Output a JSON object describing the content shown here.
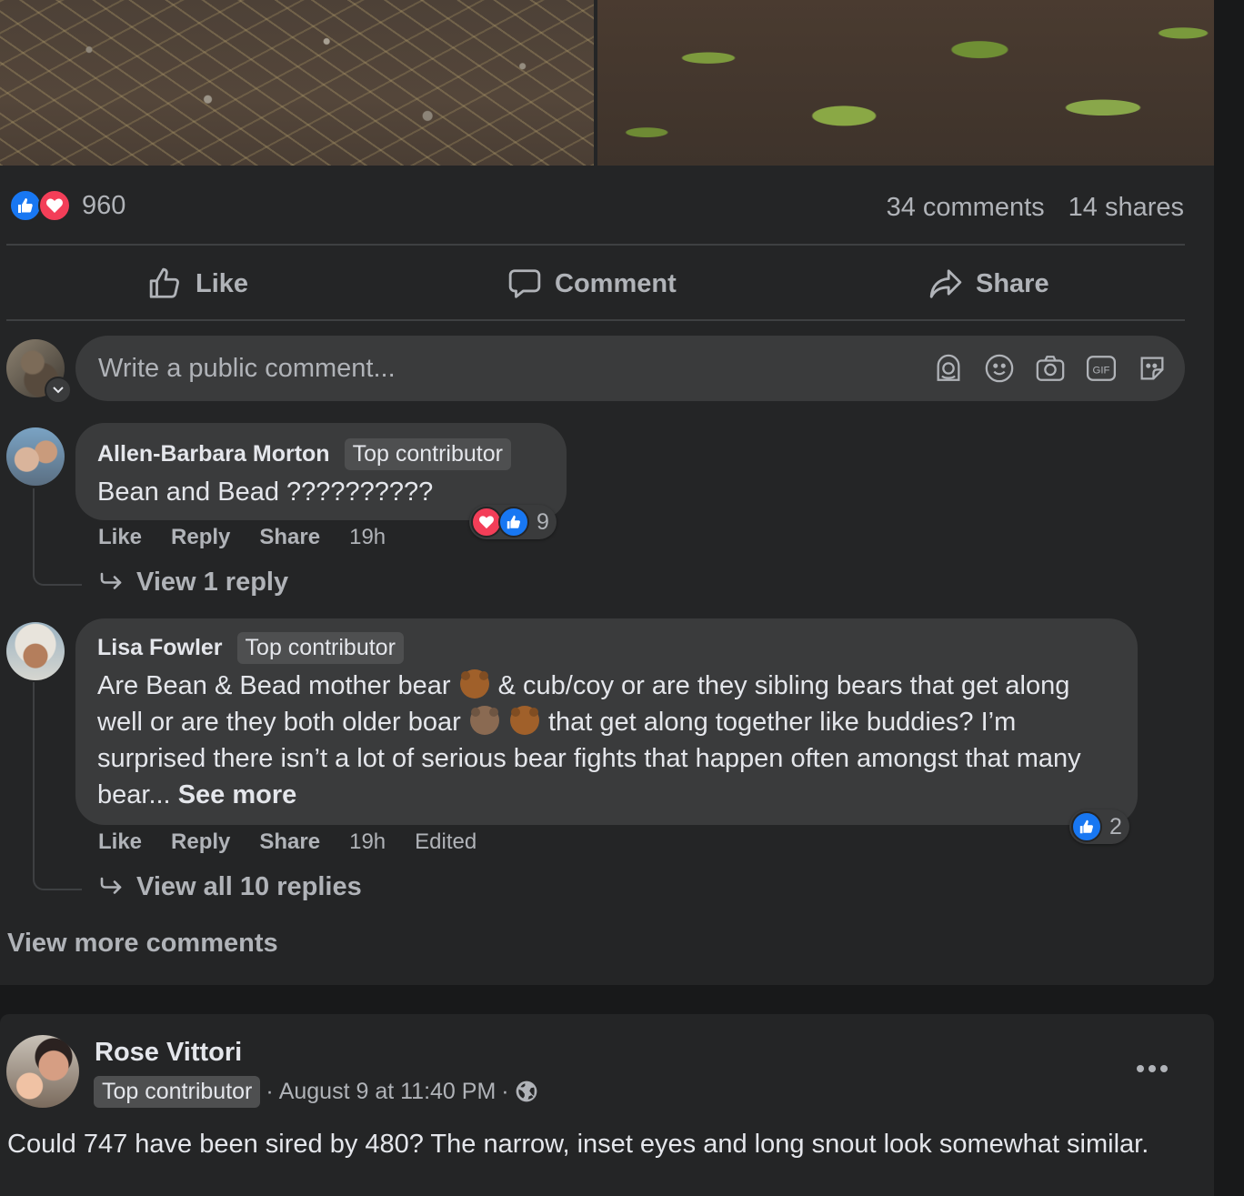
{
  "post": {
    "reaction_count": "960",
    "comments_count": "34 comments",
    "shares_count": "14 shares",
    "actions": {
      "like": "Like",
      "comment": "Comment",
      "share": "Share"
    },
    "composer_placeholder": "Write a public comment..."
  },
  "comments": [
    {
      "author": "Allen-Barbara Morton",
      "badge": "Top contributor",
      "text": "Bean and Bead ??????????",
      "like": "Like",
      "reply": "Reply",
      "share": "Share",
      "time": "19h",
      "reactions": "9",
      "view_replies": "View 1 reply"
    },
    {
      "author": "Lisa Fowler",
      "badge": "Top contributor",
      "text_1": "Are Bean & Bead mother bear",
      "text_2": "& cub/coy or are they sibling bears that get along well or are they both older boar",
      "text_3": "that get along together like buddies? I’m surprised there isn’t a lot of serious bear fights that happen often amongst that many bear...",
      "see_more": "See more",
      "like": "Like",
      "reply": "Reply",
      "share": "Share",
      "time": "19h",
      "edited": "Edited",
      "reactions": "2",
      "view_replies": "View all 10 replies"
    }
  ],
  "view_more_comments": "View more comments",
  "next_post": {
    "author": "Rose Vittori",
    "badge": "Top contributor",
    "separator_1": "·",
    "date": "August 9 at 11:40 PM",
    "separator_2": "·",
    "text": "Could 747 have been sired by 480? The narrow, inset eyes and long snout look somewhat similar."
  },
  "colors": {
    "like_blue": "#1877f2",
    "love_red": "#f33e58",
    "background": "#18191a",
    "card": "#242526"
  }
}
